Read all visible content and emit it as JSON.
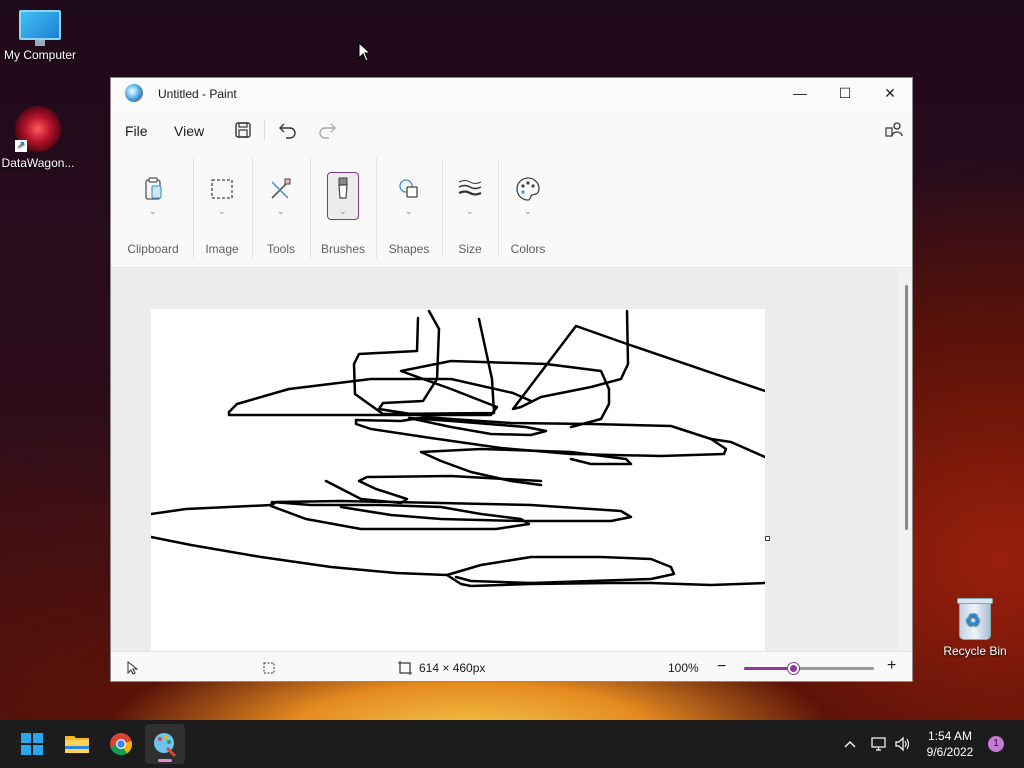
{
  "desktop": {
    "icons": [
      {
        "label": "My Computer",
        "icon": "computer-icon"
      },
      {
        "label": "DataWagon...",
        "icon": "datawagon-icon"
      },
      {
        "label": "Recycle Bin",
        "icon": "recycle-bin-icon"
      }
    ]
  },
  "window": {
    "title": "Untitled - Paint",
    "controls": {
      "minimize": "—",
      "maximize": "☐",
      "close": "✕"
    }
  },
  "menubar": {
    "file": "File",
    "view": "View",
    "icons": [
      "save-icon",
      "undo-icon",
      "redo-icon",
      "account-icon"
    ]
  },
  "ribbon": {
    "groups": [
      {
        "label": "Clipboard",
        "icon": "clipboard-icon"
      },
      {
        "label": "Image",
        "icon": "selection-icon"
      },
      {
        "label": "Tools",
        "icon": "tools-icon"
      },
      {
        "label": "Brushes",
        "icon": "brush-icon",
        "selected": true
      },
      {
        "label": "Shapes",
        "icon": "shapes-icon"
      },
      {
        "label": "Size",
        "icon": "size-icon"
      },
      {
        "label": "Colors",
        "icon": "palette-icon"
      }
    ]
  },
  "statusbar": {
    "canvas_size": "614 × 460px",
    "zoom_label": "100%",
    "zoom_level": 0.38,
    "zoom_out": "−",
    "zoom_in": "+"
  },
  "taskbar": {
    "apps": [
      "start-icon",
      "file-explorer-icon",
      "chrome-icon",
      "paint-icon"
    ],
    "time": "1:54 AM",
    "date": "9/6/2022",
    "notifications": "1"
  },
  "colors": {
    "accent": "#8a3a95",
    "taskbar": "#1c1c1c"
  }
}
